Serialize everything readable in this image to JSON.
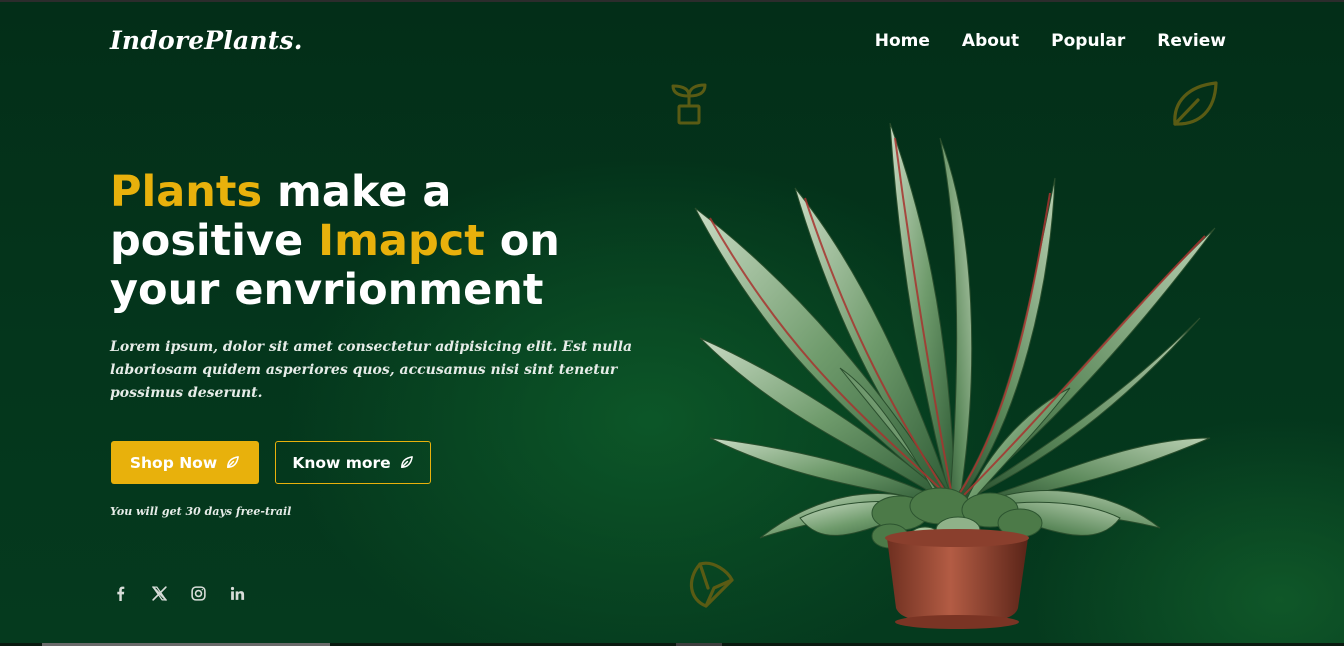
{
  "brand": {
    "logo": "IndorePlants."
  },
  "nav": {
    "items": [
      "Home",
      "About",
      "Popular",
      "Review"
    ]
  },
  "hero": {
    "headline": {
      "part1_accent": "Plants",
      "part2": " make a",
      "part3": "positive ",
      "part4_accent": "Imapct",
      "part5": " on",
      "part6": "your envrionment"
    },
    "description": "Lorem ipsum, dolor sit amet consectetur adipisicing elit. Est nulla laboriosam quidem asperiores quos, accusamus nisi sint tenetur possimus deserunt.",
    "buttons": {
      "shop_now": "Shop Now",
      "know_more": "Know more"
    },
    "trial_note": "You will get 30 days free-trail"
  },
  "socials": [
    "facebook-icon",
    "x-twitter-icon",
    "instagram-icon",
    "linkedin-icon"
  ],
  "colors": {
    "background": "#02311a",
    "accent": "#e8b10c",
    "text": "#ffffff",
    "decor_icon": "#5a5b14"
  },
  "decor_icons": [
    "sprout-pot-icon",
    "leaf-icon",
    "leaf-icon"
  ]
}
